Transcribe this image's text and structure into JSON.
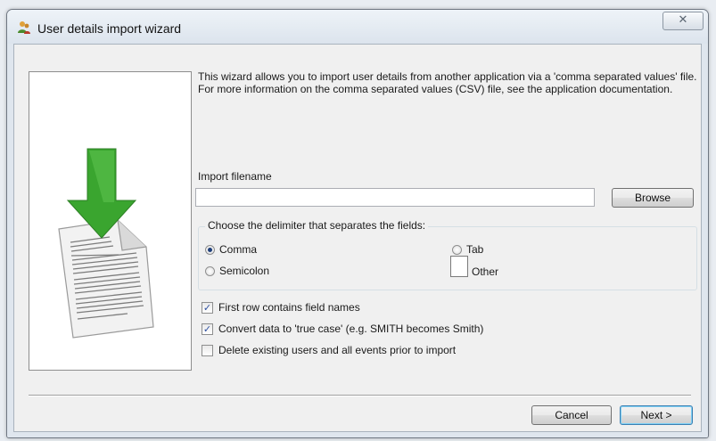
{
  "window": {
    "title": "User details import wizard",
    "close_glyph": "✕",
    "icon": "users-icon"
  },
  "intro_text": "This wizard allows you to import user details from another application via a 'comma separated values' file. For more information on the comma separated values (CSV) file, see the application documentation.",
  "graphic": {
    "icon": "document-download-icon",
    "arrow_color": "#3aa52f",
    "page_color": "#f4f4f4"
  },
  "import_file": {
    "label": "Import filename",
    "value": "",
    "placeholder": "",
    "browse_label": "Browse"
  },
  "delimiter": {
    "caption": "Choose the delimiter that separates the fields:",
    "options": [
      {
        "label": "Comma",
        "selected": true
      },
      {
        "label": "Semicolon",
        "selected": false
      },
      {
        "label": "Tab",
        "selected": false
      },
      {
        "label": "Other",
        "selected": false
      }
    ],
    "other_value": ""
  },
  "checkboxes": [
    {
      "label": "First row contains field names",
      "checked": true
    },
    {
      "label": "Convert data to 'true case' (e.g. SMITH becomes Smith)",
      "checked": true
    },
    {
      "label": "Delete existing users and all events prior to import",
      "checked": false
    }
  ],
  "buttons": {
    "cancel_label": "Cancel",
    "next_label": "Next >"
  }
}
